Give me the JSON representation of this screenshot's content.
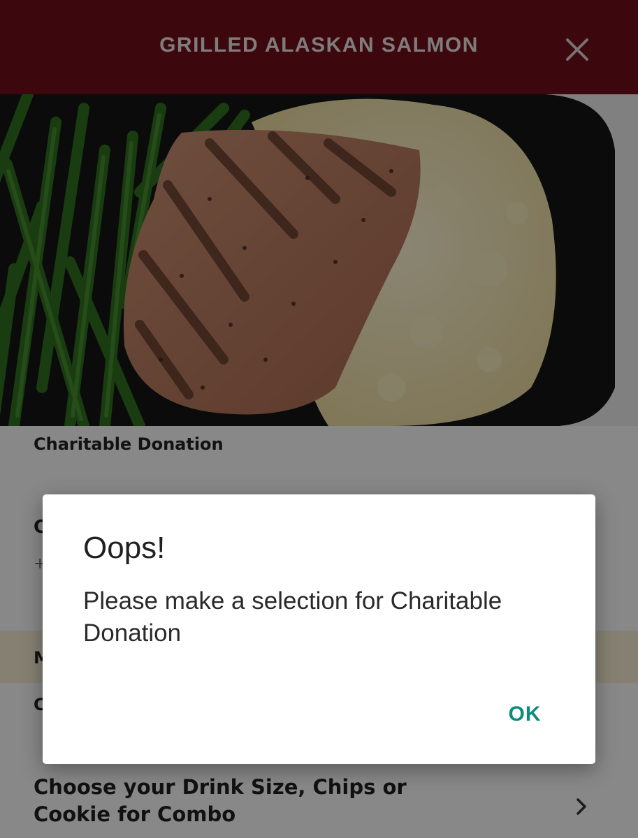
{
  "header": {
    "title": "GRILLED ALASKAN SALMON",
    "close_icon": "close-icon"
  },
  "hero": {
    "image_description": ""
  },
  "sections": {
    "charitable_donation_label": "Charitable Donation",
    "option_row_title_partial": "C",
    "option_row_sub_partial": "+",
    "band_label_partial": "M",
    "row2_label_partial": "C"
  },
  "combo": {
    "label": "Choose your Drink Size, Chips or Cookie  for Combo",
    "chevron_icon": "chevron-right-icon"
  },
  "dialog": {
    "title": "Oops!",
    "message": "Please make a selection for Charitable Donation",
    "ok_label": "OK"
  },
  "colors": {
    "header_bg": "#6e0f1a",
    "accent": "#0e8a7e",
    "band_bg": "#f3e9cf"
  }
}
